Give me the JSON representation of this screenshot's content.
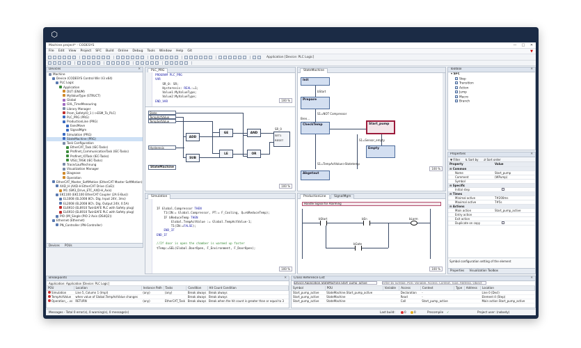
{
  "window": {
    "title": "Machine.project* - CODESYS",
    "controls": [
      "—",
      "□",
      "✕"
    ]
  },
  "menu": [
    "File",
    "Edit",
    "View",
    "Project",
    "SFC",
    "Build",
    "Online",
    "Debug",
    "Tools",
    "Window",
    "Help",
    "Git"
  ],
  "toolbar": {
    "breadcrumb": "Application [Device: PLC Logic]"
  },
  "devices": {
    "title": "Devices",
    "rows": [
      {
        "indent": 0,
        "label": "Machine",
        "color": "#7a8aa8"
      },
      {
        "indent": 1,
        "label": "Device (CODESYS Control Win V3 x64)",
        "color": "#5a7ab0"
      },
      {
        "indent": 2,
        "label": "PLC Logic",
        "color": "#5a7ab0"
      },
      {
        "indent": 3,
        "label": "Application",
        "color": "#3c8c3c"
      },
      {
        "indent": 4,
        "label": "DUT (ENUM)",
        "color": "#d08a2a"
      },
      {
        "indent": 4,
        "label": "MyValueType (STRUCT)",
        "color": "#d08a2a"
      },
      {
        "indent": 4,
        "label": "Global",
        "color": "#a06ac0"
      },
      {
        "indent": 4,
        "label": "GVL_TimeMeasuring",
        "color": "#a06ac0"
      },
      {
        "indent": 4,
        "label": "Library Manager",
        "color": "#7a8aa8"
      },
      {
        "indent": 4,
        "label": "Prom_SafetyIO_1 (->ESM_To_PLC)",
        "color": "#c03030"
      },
      {
        "indent": 4,
        "label": "PLC_PRG (PRG)",
        "color": "#3a6ac0"
      },
      {
        "indent": 4,
        "label": "ProductionLine (PRG)",
        "color": "#3a6ac0"
      },
      {
        "indent": 5,
        "label": "ExecMove",
        "color": "#3a6ac0"
      },
      {
        "indent": 5,
        "label": "SignalMgm",
        "color": "#3a6ac0"
      },
      {
        "indent": 4,
        "label": "Simulation (PRG)",
        "color": "#3a6ac0"
      },
      {
        "indent": 4,
        "label": "StateMachine (PRG)",
        "color": "#3a6ac0",
        "selected": true
      },
      {
        "indent": 4,
        "label": "Task Configuration",
        "color": "#7a8aa8"
      },
      {
        "indent": 5,
        "label": "EtherCAT_Task (IEC-Tasks)",
        "color": "#3c8c3c"
      },
      {
        "indent": 5,
        "label": "Profinet_CommunicationTask (IEC-Tasks)",
        "color": "#3c8c3c"
      },
      {
        "indent": 5,
        "label": "Profinet_IOTask (IEC-Tasks)",
        "color": "#3c8c3c"
      },
      {
        "indent": 5,
        "label": "VISU_TASK (IEC-Tasks)",
        "color": "#3c8c3c"
      },
      {
        "indent": 4,
        "label": "Trace/LaufRechnung",
        "color": "#7a8aa8"
      },
      {
        "indent": 4,
        "label": "Visualization Manager",
        "color": "#7a8aa8"
      },
      {
        "indent": 4,
        "label": "Diagnose",
        "color": "#d08a2a"
      },
      {
        "indent": 4,
        "label": "Operation",
        "color": "#d08a2a"
      },
      {
        "indent": 1,
        "label": "EtherCAT_Master_SoftMotion (EtherCAT Master SoftMotion)",
        "color": "#5a7ab0"
      },
      {
        "indent": 2,
        "label": "AXD_H (AXD-H EtherCAT Drive (CoE))",
        "color": "#5a7ab0"
      },
      {
        "indent": 3,
        "label": "M1 (SM3_Drive_ETC_AXD-H_Axis)",
        "color": "#d08a2a"
      },
      {
        "indent": 2,
        "label": "EK1100 (EK1100 EtherCAT Coupler (2A E-Bus))",
        "color": "#5a7ab0"
      },
      {
        "indent": 3,
        "label": "EL1008 (EL1008 8Ch. Dig. Input 24V, 3ms)",
        "color": "#5a7ab0"
      },
      {
        "indent": 3,
        "label": "EL2008 (EL2008 8Ch. Dig. Output 24V, 0.5A)",
        "color": "#5a7ab0"
      },
      {
        "indent": 3,
        "label": "EL6910 (EL6910 TwinSAFE PLC with Safety plug)",
        "color": "#c03030"
      },
      {
        "indent": 3,
        "label": "EL6910 (EL6910 TwinSAFE PLC with Safety plug)",
        "color": "#c03030"
      },
      {
        "indent": 2,
        "label": "PIO (IM_Single (PIO 2 Axis (DS4Q2))",
        "color": "#5a7ab0"
      },
      {
        "indent": 1,
        "label": "Ethernet (Ethernet)",
        "color": "#5a7ab0"
      },
      {
        "indent": 2,
        "label": "PN_Controller (PN-Controller)",
        "color": "#5a7ab0"
      }
    ],
    "bottom_tabs": [
      "Devices",
      "POUs"
    ]
  },
  "plc_prg": {
    "tab": "PLC_PRG",
    "lines": [
      [
        {
          "t": "PROGRAM PLC_PRG",
          "c": "kw"
        }
      ],
      [
        {
          "t": "VAR",
          "c": "kw"
        }
      ],
      [
        {
          "t": "    SR_0: SR;",
          "c": ""
        }
      ],
      [
        {
          "t": "    Hysteresis: ",
          "c": ""
        },
        {
          "t": "REAL",
          "c": "kw"
        },
        {
          "t": ":=1;",
          "c": ""
        }
      ],
      [
        {
          "t": "    Value1:MyValueType;",
          "c": ""
        }
      ],
      [
        {
          "t": "    Value2:MyValueType;",
          "c": ""
        }
      ],
      [
        {
          "t": "END_VAR",
          "c": "kw"
        }
      ]
    ],
    "zoom": "100 %"
  },
  "fbd": {
    "vars": [
      "State",
      "TempActValue",
      "TempSetValue",
      "Hysteresis"
    ],
    "blocks": [
      "ADD",
      "SUB",
      "GE",
      "LE",
      "AND",
      "OR"
    ],
    "sr": "SR_0",
    "sr_pins": [
      "SET1",
      "RESET"
    ],
    "bottom_label": "StateMachine",
    "zoom": "100 %"
  },
  "state_machine": {
    "tab": "StateMachine",
    "steps": [
      "Init",
      "Prepare",
      "CheckTemp",
      "Start_pump",
      "Empty",
      "Abgetaut"
    ],
    "transitions": [
      "bStart",
      "S1=NOT Compressor",
      "Bren...",
      "S1=Sensor_empty",
      "S1=TempActValue>Statetemp"
    ],
    "zoom": "100 %"
  },
  "simulation": {
    "tab": "Simulation",
    "lines": [
      [
        {
          "t": "IF Global.Compressor ",
          "c": ""
        },
        {
          "t": "THEN",
          "c": "kw"
        }
      ],
      [
        {
          "t": "    T1(IN:= Global.Compressor, PT:= F_Cooling, Q=>bReduceTemp);",
          "c": ""
        }
      ],
      [
        {
          "t": "    IF bReduceTemp ",
          "c": ""
        },
        {
          "t": "THEN",
          "c": "kw"
        }
      ],
      [
        {
          "t": "        Global.TempActValue := Global.TempActValue-1;",
          "c": ""
        }
      ],
      [
        {
          "t": "        T1(IN:=",
          "c": ""
        },
        {
          "t": "FALSE",
          "c": "kw"
        },
        {
          "t": ");",
          "c": ""
        }
      ],
      [
        {
          "t": "    END_IF",
          "c": "kw"
        }
      ],
      [
        {
          "t": "END_IF",
          "c": "kw"
        }
      ],
      [
        {
          "t": "",
          "c": ""
        }
      ],
      [
        {
          "t": "//If door is open the chamber is warmed up faster",
          "c": "cm"
        }
      ],
      [
        {
          "t": "tTemp:=SEL(Global.DoorOpen, F_Environment, F_DoorOpen);",
          "c": ""
        }
      ]
    ],
    "zoom": "100 %"
  },
  "production_line": {
    "tab": "ProductionLine",
    "tab2": "SignalMgm",
    "comment": "Handle Signal for Alarming",
    "contacts": [
      "bStart",
      "bEn",
      "bLarm",
      "bGate"
    ],
    "zoom": "100 %"
  },
  "toolbox": {
    "title": "Toolbox",
    "group": "SFC",
    "items": [
      "Step",
      "Transition",
      "Action",
      "Jump",
      "Macro",
      "Branch"
    ]
  },
  "properties": {
    "title": "Properties",
    "filter": "Filter",
    "sort_by": "Sort by",
    "sort_order": "Sort order",
    "col_property": "Property",
    "col_value": "Value",
    "rows": [
      {
        "group": true,
        "name": "Common",
        "value": ""
      },
      {
        "group": false,
        "name": "Name",
        "value": "Start_pump"
      },
      {
        "group": false,
        "name": "Comment",
        "value": "(WPump)"
      },
      {
        "group": false,
        "name": "Symbol",
        "value": ""
      },
      {
        "group": true,
        "name": "Specific",
        "value": ""
      },
      {
        "group": false,
        "name": "Initial step",
        "value": ""
      },
      {
        "group": true,
        "name": "Times",
        "value": ""
      },
      {
        "group": false,
        "name": "Minimal active",
        "value": "T#200ms"
      },
      {
        "group": false,
        "name": "Maximal active",
        "value": "T#5s"
      },
      {
        "group": true,
        "name": "Actions",
        "value": ""
      },
      {
        "group": false,
        "name": "Main action",
        "value": "Start_pump_active"
      },
      {
        "group": false,
        "name": "Entry action",
        "value": ""
      },
      {
        "group": false,
        "name": "Exit action",
        "value": ""
      },
      {
        "group": false,
        "name": "Duplicate on copy",
        "value": ""
      }
    ],
    "description": "Symbol configuration setting of the element",
    "bottom_tabs": [
      "Properties",
      "Visualization Toolbox"
    ]
  },
  "breakpoints": {
    "title": "Breakpoints",
    "application": "Application: Application [Device: PLC Logic]",
    "columns": [
      "POU",
      "Location",
      "Instance Path",
      "Tasks",
      "Condition",
      "Hit Count Condition"
    ],
    "rows": [
      [
        "Simulation",
        "Line 5, Column 1 (Impl)",
        "(any)",
        "(any)",
        "Break always",
        "Break always"
      ],
      [
        "TempActValue",
        "when value of Global.TempActValue changes",
        "",
        "",
        "Break always",
        "Break always"
      ],
      [
        "Operation_...vs",
        "RETURN",
        "(any)",
        "EtherCAT_Task",
        "Break always",
        "Break when the hit count is greater than or equal to 3"
      ]
    ]
  },
  "cross_ref": {
    "title": "Cross Reference List",
    "search": "Device.Application.StateMachine.Start_pump_active",
    "scope": "Filter by Symbol, POU, Variable, Access, Context, Type, Address, Object",
    "columns": [
      "Symbol",
      "POU",
      "Variable",
      "Access",
      "Context",
      "Type",
      "Address",
      "Location"
    ],
    "rows": [
      [
        "Start_pump_active",
        "StateMachine.Start_pump_active",
        "",
        "Declaration",
        "-",
        "",
        "",
        "Line 0 (Decl)"
      ],
      [
        "Start_pump_active",
        "StateMachine",
        "",
        "Read",
        "-",
        "",
        "",
        "Element 4 (Step)"
      ],
      [
        "Start_pump_active",
        "StateMachine",
        "",
        "Call",
        "Start_pump_active",
        "",
        "",
        "Main action Start_pump_active"
      ]
    ]
  },
  "status": {
    "messages": "Messages - Total 0 error(s), 0 warning(s), 0 message(s)",
    "last_build": "Last build:",
    "build_errors": "0",
    "build_warnings": "0",
    "precompile": "Precompile",
    "precompile_check": "✓",
    "user": "Project user: (nobody)"
  }
}
